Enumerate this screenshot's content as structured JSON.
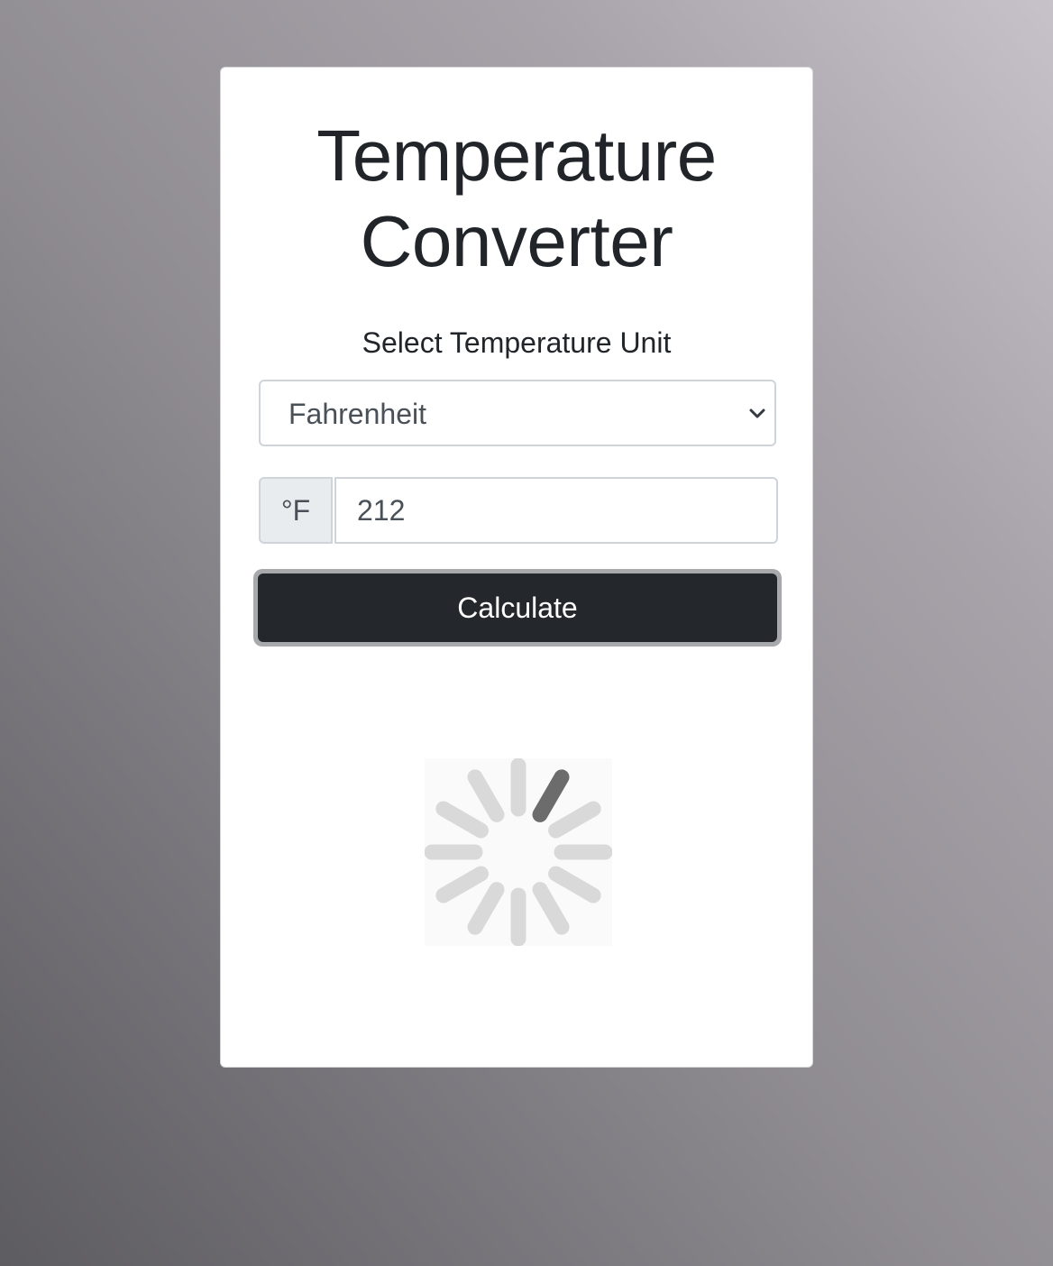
{
  "title": "Temperature Converter",
  "unit_selector": {
    "label": "Select Temperature Unit",
    "selected": "Fahrenheit"
  },
  "temperature_input": {
    "unit_symbol": "°F",
    "value": "212"
  },
  "calculate_button": {
    "label": "Calculate"
  },
  "colors": {
    "button_bg": "#24282d",
    "text": "#212529",
    "spinner_active": "#6c6c6c",
    "spinner_inactive": "#d9d9d9"
  },
  "icons": {
    "select_arrow": "chevron-down-icon",
    "loading": "loading-spinner-icon"
  }
}
